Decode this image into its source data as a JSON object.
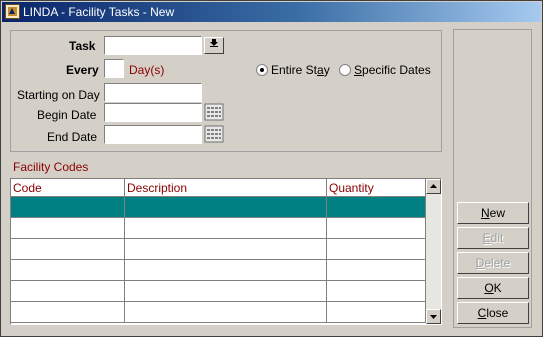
{
  "window": {
    "title": "LINDA - Facility Tasks - New"
  },
  "form": {
    "task_label": "Task",
    "task_value": "",
    "every_label": "Every",
    "every_value": "",
    "days_label": "Day(s)",
    "entire_stay_label_pre": "Entire St",
    "entire_stay_label_ul": "a",
    "entire_stay_label_post": "y",
    "specific_dates_label_ul": "S",
    "specific_dates_label_post": "pecific Dates",
    "selected_radio": "entire_stay",
    "starting_on_day_label": "Starting on Day",
    "begin_date_label": "Begin Date",
    "end_date_label": "End Date"
  },
  "facility_codes": {
    "title": "Facility Codes",
    "columns": [
      "Code",
      "Description",
      "Quantity"
    ],
    "rows": [
      [
        "",
        "",
        ""
      ],
      [
        "",
        "",
        ""
      ],
      [
        "",
        "",
        ""
      ],
      [
        "",
        "",
        ""
      ],
      [
        "",
        "",
        ""
      ],
      [
        "",
        "",
        ""
      ]
    ]
  },
  "buttons": {
    "new": {
      "ul": "N",
      "rest": "ew"
    },
    "edit": {
      "ul": "E",
      "rest": "dit"
    },
    "delete": {
      "ul": "D",
      "rest": "elete"
    },
    "ok": {
      "ul": "O",
      "rest": "K"
    },
    "close": {
      "ul": "C",
      "rest": "lose"
    }
  },
  "colors": {
    "accent_label": "#8b0000",
    "selection": "#008080",
    "title_start": "#0a246a"
  }
}
